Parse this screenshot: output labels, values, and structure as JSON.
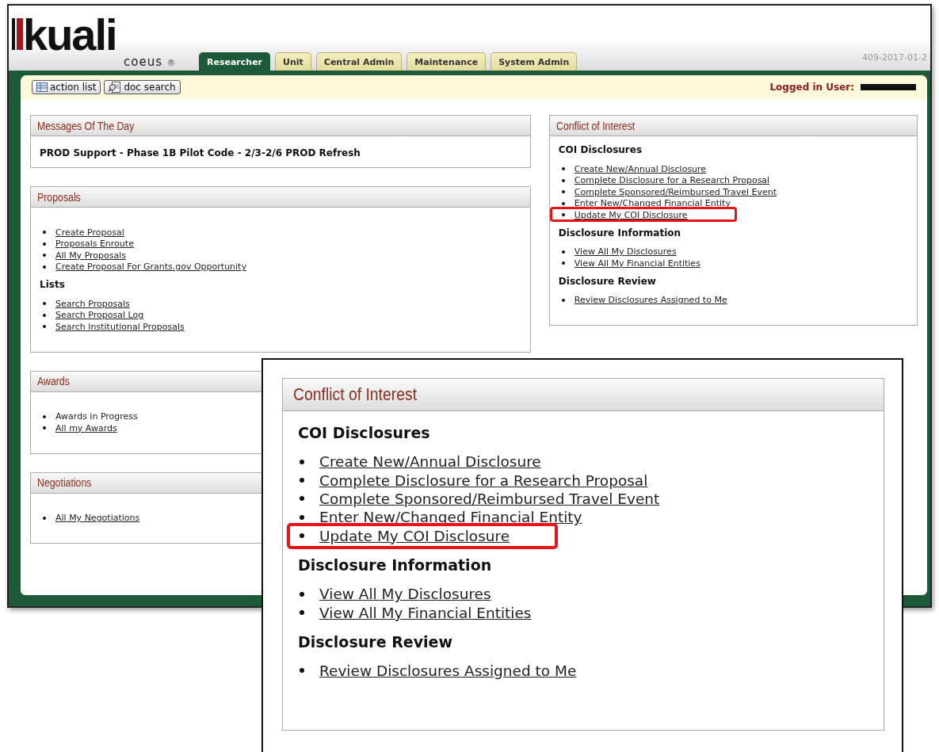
{
  "header": {
    "logo": "kuali",
    "product": "coeus",
    "registered_mark": "®",
    "version": "409-2017-01-2"
  },
  "tabs": [
    {
      "label": "Researcher",
      "selected": true
    },
    {
      "label": "Unit",
      "selected": false
    },
    {
      "label": "Central Admin",
      "selected": false
    },
    {
      "label": "Maintenance",
      "selected": false
    },
    {
      "label": "System Admin",
      "selected": false
    }
  ],
  "toolbar": {
    "buttons": [
      {
        "label": "action list",
        "kind": "list"
      },
      {
        "label": "doc search",
        "kind": "search"
      }
    ],
    "logged_in_label": "Logged in User:"
  },
  "columns": [
    {
      "panels": [
        {
          "title": "Messages Of The Day",
          "message": "PROD Support - Phase 1B Pilot Code - 2/3-2/6 PROD Refresh"
        },
        {
          "title": "Proposals",
          "sections": [
            {
              "links": [
                {
                  "text": "Create Proposal",
                  "kind": "link",
                  "highlighted": false
                },
                {
                  "text": "Proposals Enroute",
                  "kind": "link",
                  "highlighted": false
                },
                {
                  "text": "All My Proposals",
                  "kind": "link",
                  "highlighted": false
                },
                {
                  "text": "Create Proposal For Grants.gov Opportunity",
                  "kind": "link",
                  "highlighted": false
                }
              ]
            },
            {
              "heading": "Lists",
              "links": [
                {
                  "text": "Search Proposals",
                  "kind": "link",
                  "highlighted": false
                },
                {
                  "text": "Search Proposal Log",
                  "kind": "link",
                  "highlighted": false
                },
                {
                  "text": "Search Institutional Proposals",
                  "kind": "link",
                  "highlighted": false
                }
              ]
            }
          ]
        },
        {
          "title": "Awards",
          "sections": [
            {
              "links": [
                {
                  "text": "Awards in Progress",
                  "kind": "text",
                  "highlighted": false
                },
                {
                  "text": "All my Awards",
                  "kind": "link",
                  "highlighted": false
                }
              ]
            }
          ]
        },
        {
          "title": "Negotiations",
          "sections": [
            {
              "links": [
                {
                  "text": "All My Negotiations",
                  "kind": "link",
                  "highlighted": false
                }
              ]
            }
          ]
        }
      ]
    },
    {
      "panels": [
        {
          "title": "Conflict of Interest",
          "sections": [
            {
              "heading": "COI Disclosures",
              "links": [
                {
                  "text": "Create New/Annual Disclosure",
                  "kind": "link",
                  "highlighted": false
                },
                {
                  "text": "Complete Disclosure for a Research Proposal",
                  "kind": "link",
                  "highlighted": false
                },
                {
                  "text": "Complete Sponsored/Reimbursed Travel Event",
                  "kind": "link",
                  "highlighted": false
                },
                {
                  "text": "Enter New/Changed Financial Entity",
                  "kind": "link",
                  "highlighted": false
                },
                {
                  "text": "Update My COI Disclosure",
                  "kind": "link",
                  "highlighted": true
                }
              ]
            },
            {
              "heading": "Disclosure Information",
              "links": [
                {
                  "text": "View All My Disclosures",
                  "kind": "link",
                  "highlighted": false
                },
                {
                  "text": "View All My Financial Entities",
                  "kind": "link",
                  "highlighted": false
                }
              ]
            },
            {
              "heading": "Disclosure Review",
              "links": [
                {
                  "text": "Review Disclosures Assigned to Me",
                  "kind": "link",
                  "highlighted": false
                }
              ]
            }
          ]
        }
      ]
    }
  ],
  "callout": {
    "panel": {
      "title": "Conflict of Interest",
      "sections": [
        {
          "heading": "COI Disclosures",
          "links": [
            {
              "text": "Create New/Annual Disclosure",
              "kind": "link",
              "highlighted": false
            },
            {
              "text": "Complete Disclosure for a Research Proposal",
              "kind": "link",
              "highlighted": false
            },
            {
              "text": "Complete Sponsored/Reimbursed Travel Event",
              "kind": "link",
              "highlighted": false
            },
            {
              "text": "Enter New/Changed Financial Entity",
              "kind": "link",
              "highlighted": false
            },
            {
              "text": "Update My COI Disclosure",
              "kind": "link",
              "highlighted": true
            }
          ]
        },
        {
          "heading": "Disclosure Information",
          "links": [
            {
              "text": "View All My Disclosures",
              "kind": "link",
              "highlighted": false
            },
            {
              "text": "View All My Financial Entities",
              "kind": "link",
              "highlighted": false
            }
          ]
        },
        {
          "heading": "Disclosure Review",
          "links": [
            {
              "text": "Review Disclosures Assigned to Me",
              "kind": "link",
              "highlighted": false
            }
          ]
        }
      ]
    }
  }
}
